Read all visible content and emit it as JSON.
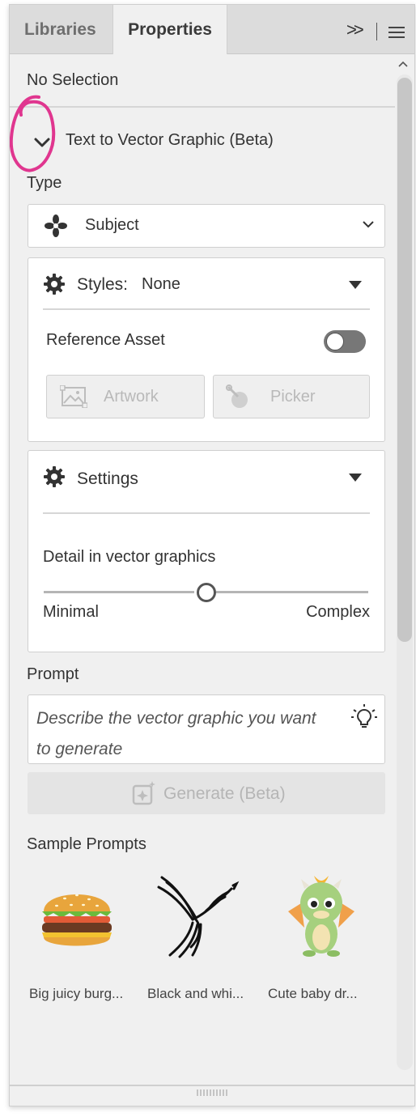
{
  "tabs": [
    {
      "label": "Libraries",
      "active": false
    },
    {
      "label": "Properties",
      "active": true
    }
  ],
  "header_icons": {
    "expand": "double-chevron-right-icon",
    "menu": "hamburger-icon",
    "expand_glyph": ">>"
  },
  "selection_label": "No Selection",
  "section": {
    "title": "Text to Vector Graphic (Beta)",
    "expanded": true
  },
  "type": {
    "label": "Type",
    "value": "Subject",
    "icon": "subject-icon"
  },
  "styles": {
    "label": "Styles:",
    "value": "None",
    "reference_label": "Reference Asset",
    "reference_on": false,
    "artwork_label": "Artwork",
    "picker_label": "Picker"
  },
  "settings": {
    "title": "Settings",
    "detail_label": "Detail in vector graphics",
    "min_label": "Minimal",
    "max_label": "Complex",
    "detail_level": 0.5
  },
  "prompt": {
    "label": "Prompt",
    "placeholder": "Describe the vector graphic you want to generate"
  },
  "generate_label": "Generate (Beta)",
  "samples": {
    "title": "Sample Prompts",
    "items": [
      {
        "caption": "Big juicy burg...",
        "icon": "burger-icon"
      },
      {
        "caption": "Black and whi...",
        "icon": "bird-icon"
      },
      {
        "caption": "Cute baby dr...",
        "icon": "dragon-icon"
      }
    ]
  },
  "colors": {
    "annotation": "#e0368f",
    "panel": "#f0f0f0",
    "text": "#2c2c2c"
  }
}
